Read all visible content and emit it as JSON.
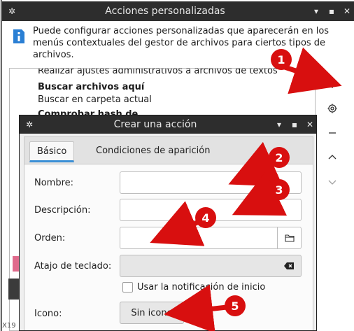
{
  "back_window": {
    "title": "Acciones personalizadas",
    "info_text": "Puede configurar acciones personalizadas que aparecerán en los menús contextuales del gestor de archivos para ciertos tipos de archivos.",
    "list_items": [
      {
        "text": "Realizar ajustes administrativos a archivos de textos",
        "bold": false
      },
      {
        "text": "Buscar archivos aquí",
        "bold": true
      },
      {
        "text": "Buscar en carpeta actual",
        "bold": false
      },
      {
        "text": "Comprobar hash de...",
        "bold": true
      }
    ],
    "side_buttons": [
      {
        "name": "add-icon"
      },
      {
        "name": "settings-icon"
      },
      {
        "name": "remove-icon"
      },
      {
        "name": "move-up-icon"
      },
      {
        "name": "move-down-icon"
      }
    ],
    "left_fragment": "X19"
  },
  "dialog": {
    "title": "Crear una acción",
    "tabs": [
      {
        "label": "Básico",
        "active": true
      },
      {
        "label": "Condiciones de aparición",
        "active": false
      }
    ],
    "fields": {
      "name_label": "Nombre:",
      "name_value": "",
      "description_label": "Descripción:",
      "description_value": "",
      "order_label": "Orden:",
      "order_value": "",
      "shortcut_label": "Atajo de teclado:",
      "shortcut_value": "",
      "notify_label": "Usar la notificación de inicio",
      "notify_checked": false,
      "icon_label": "Icono:",
      "icon_button": "Sin icono"
    }
  },
  "annotations": {
    "color": "#d80f0f",
    "badges": [
      "1",
      "2",
      "3",
      "4",
      "5"
    ]
  },
  "colors": {
    "titlebar": "#2d2d2d",
    "tab_accent": "#3b8fd6",
    "info_icon": "#2a7fd4"
  }
}
